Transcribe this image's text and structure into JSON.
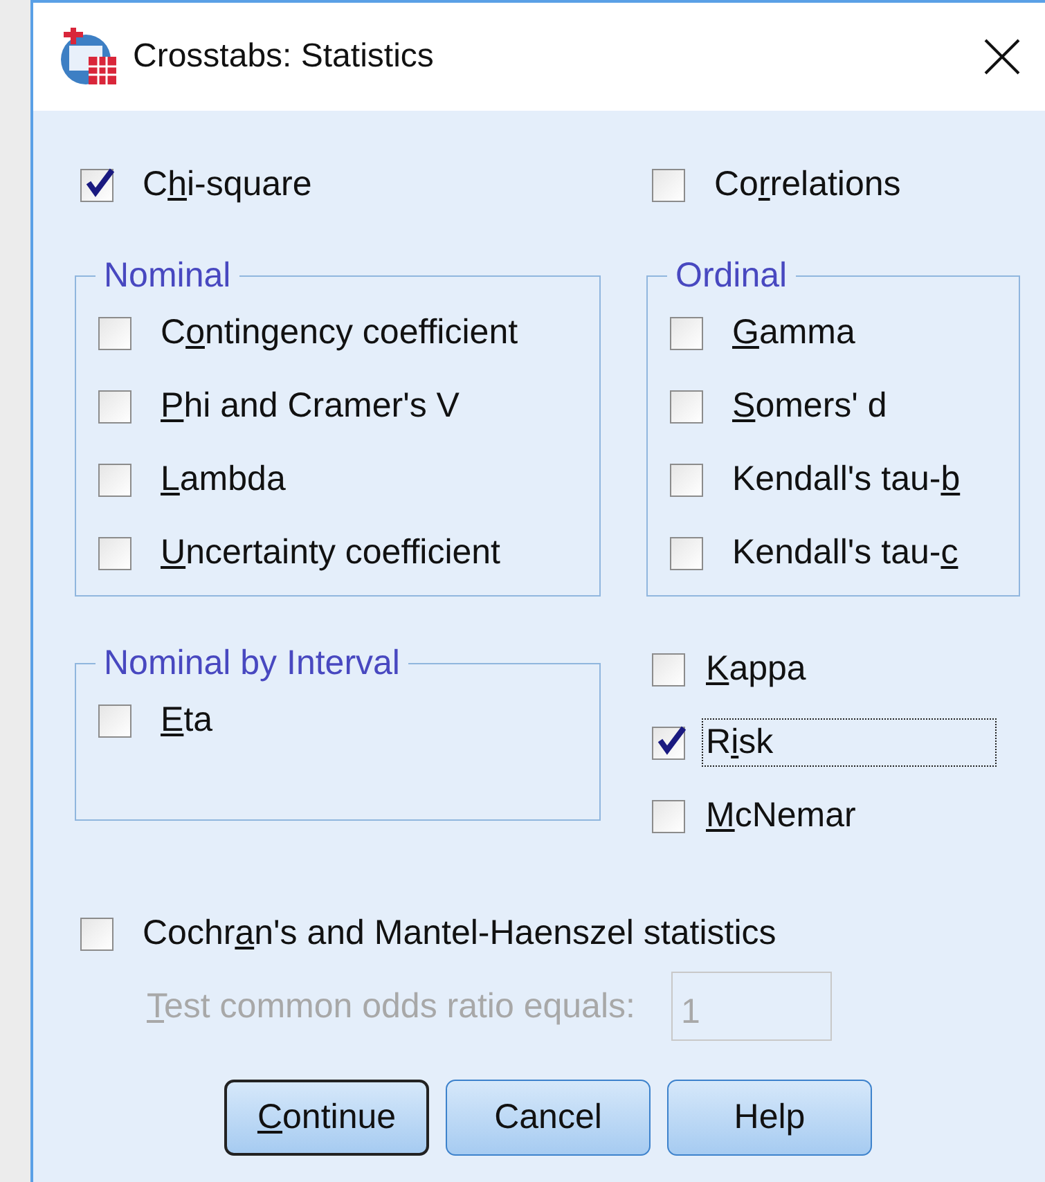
{
  "window": {
    "title": "Crosstabs: Statistics"
  },
  "top": [
    {
      "label": [
        {
          "text": "C",
          "underline": false
        },
        {
          "text": "h",
          "underline": true
        },
        {
          "text": "i-square",
          "underline": false
        }
      ],
      "checked": true,
      "focused": false
    },
    {
      "label": [
        {
          "text": "Co",
          "underline": false
        },
        {
          "text": "r",
          "underline": true
        },
        {
          "text": "relations",
          "underline": false
        }
      ],
      "checked": false,
      "focused": false
    }
  ],
  "groups": [
    {
      "legend": "Nominal",
      "items": [
        {
          "label": [
            {
              "text": "C",
              "underline": false
            },
            {
              "text": "o",
              "underline": true
            },
            {
              "text": "ntingency coefficient",
              "underline": false
            }
          ],
          "checked": false,
          "focused": false
        },
        {
          "label": [
            {
              "text": "P",
              "underline": true
            },
            {
              "text": "hi and Cramer's V",
              "underline": false
            }
          ],
          "checked": false,
          "focused": false
        },
        {
          "label": [
            {
              "text": "L",
              "underline": true
            },
            {
              "text": "ambda",
              "underline": false
            }
          ],
          "checked": false,
          "focused": false
        },
        {
          "label": [
            {
              "text": "U",
              "underline": true
            },
            {
              "text": "ncertainty coefficient",
              "underline": false
            }
          ],
          "checked": false,
          "focused": false
        }
      ]
    },
    {
      "legend": "Ordinal",
      "items": [
        {
          "label": [
            {
              "text": "G",
              "underline": true
            },
            {
              "text": "amma",
              "underline": false
            }
          ],
          "checked": false,
          "focused": false
        },
        {
          "label": [
            {
              "text": "S",
              "underline": true
            },
            {
              "text": "omers' d",
              "underline": false
            }
          ],
          "checked": false,
          "focused": false
        },
        {
          "label": [
            {
              "text": "Kendall's tau-",
              "underline": false
            },
            {
              "text": "b",
              "underline": true
            }
          ],
          "checked": false,
          "focused": false
        },
        {
          "label": [
            {
              "text": "Kendall's tau-",
              "underline": false
            },
            {
              "text": "c",
              "underline": true
            }
          ],
          "checked": false,
          "focused": false
        }
      ]
    },
    {
      "legend": "Nominal by Interval",
      "items": [
        {
          "label": [
            {
              "text": "E",
              "underline": true
            },
            {
              "text": "ta",
              "underline": false
            }
          ],
          "checked": false,
          "focused": false
        }
      ]
    }
  ],
  "agreement": [
    {
      "label": [
        {
          "text": "K",
          "underline": true
        },
        {
          "text": "appa",
          "underline": false
        }
      ],
      "checked": false,
      "focused": false
    },
    {
      "label": [
        {
          "text": "R",
          "underline": false
        },
        {
          "text": "i",
          "underline": true
        },
        {
          "text": "sk",
          "underline": false
        }
      ],
      "checked": true,
      "focused": true
    },
    {
      "label": [
        {
          "text": "M",
          "underline": true
        },
        {
          "text": "cNemar",
          "underline": false
        }
      ],
      "checked": false,
      "focused": false
    }
  ],
  "cochran": {
    "label": [
      {
        "text": "Cochr",
        "underline": false
      },
      {
        "text": "a",
        "underline": true
      },
      {
        "text": "n's and Mantel-Haenszel statistics",
        "underline": false
      }
    ],
    "checked": false,
    "focused": false
  },
  "odds_ratio": {
    "label": [
      {
        "text": "T",
        "underline": true
      },
      {
        "text": "est common odds ratio equals:",
        "underline": false
      }
    ],
    "value": "1",
    "disabled": true
  },
  "buttons": [
    {
      "label": [
        {
          "text": "C",
          "underline": true
        },
        {
          "text": "ontinue",
          "underline": false
        }
      ],
      "default": true
    },
    {
      "label": [
        {
          "text": "Cancel",
          "underline": false
        }
      ],
      "default": false
    },
    {
      "label": [
        {
          "text": "Help",
          "underline": false
        }
      ],
      "default": false
    }
  ]
}
